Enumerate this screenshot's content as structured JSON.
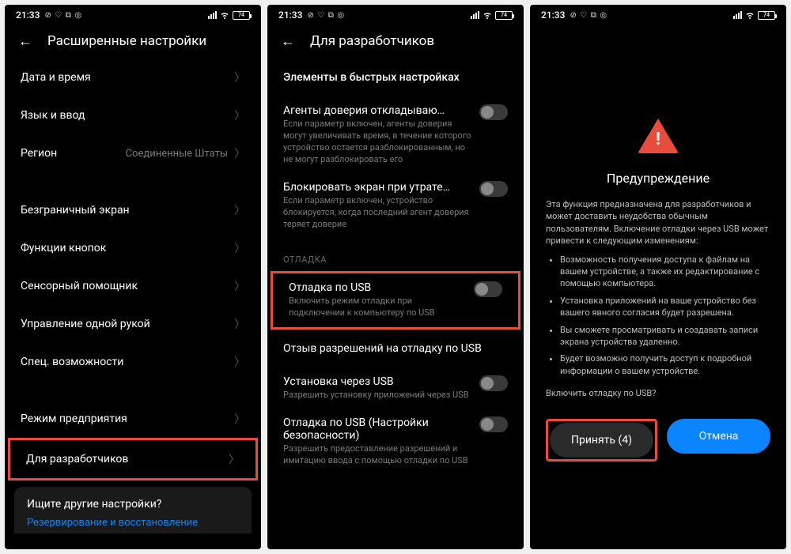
{
  "status": {
    "time": "21:33",
    "icons_left": "⊘ ♡ ⧉ ◎",
    "battery": "74"
  },
  "screen1": {
    "title": "Расширенные настройки",
    "rows": [
      {
        "label": "Дата и время"
      },
      {
        "label": "Язык и ввод"
      },
      {
        "label": "Регион",
        "value": "Соединенные Штаты"
      }
    ],
    "rows2": [
      {
        "label": "Безграничный экран"
      },
      {
        "label": "Функции кнопок"
      },
      {
        "label": "Сенсорный помощник"
      },
      {
        "label": "Управление одной рукой"
      },
      {
        "label": "Спец. возможности"
      }
    ],
    "rows3": [
      {
        "label": "Режим предприятия"
      },
      {
        "label": "Для разработчиков"
      }
    ],
    "footer": {
      "title": "Ищите другие настройки?",
      "link": "Резервирование и восстановление"
    }
  },
  "screen2": {
    "title": "Для разработчиков",
    "top_row": "Элементы в быстрых настройках",
    "rows": [
      {
        "label": "Агенты доверия откладываю…",
        "sub": "Если параметр включен, агенты доверия могут увеличивать время, в течение которого устройство остается разблокированным, но не могут разблокировать его"
      },
      {
        "label": "Блокировать экран при утрате…",
        "sub": "Если параметр включен, устройство блокируется, когда последний агент доверия теряет доверие"
      }
    ],
    "section": "ОТЛАДКА",
    "highlight": {
      "label": "Отладка по USB",
      "sub": "Включить режим отладки при подключении к компьютеру по USB"
    },
    "rows2": [
      {
        "label": "Отзыв разрешений на отладку по USB"
      },
      {
        "label": "Установка через USB",
        "sub": "Разрешить установку приложений через USB"
      },
      {
        "label": "Отладка по USB (Настройки безопасности)",
        "sub": "Разрешить предоставление разрешений и имитацию ввода с помощью отладки по USB"
      }
    ]
  },
  "screen3": {
    "title": "Предупреждение",
    "intro": "Эта функция предназначена для разработчиков и может доставить неудобства обычным пользователям. Включение отладки через USB может привести к следующим изменениям:",
    "bullets": [
      "Возможность получения доступа к файлам на вашем устройстве, а также их редактирование с помощью компьютера.",
      "Установка приложений на ваше устройство без вашего явного согласия будет разрешена.",
      "Вы сможете просматривать и создавать записи экрана устройства удаленно.",
      "Будет возможно получить доступ к подробной информации о вашем устройстве."
    ],
    "question": "Включить отладку по USB?",
    "accept": "Принять (4)",
    "cancel": "Отмена"
  }
}
